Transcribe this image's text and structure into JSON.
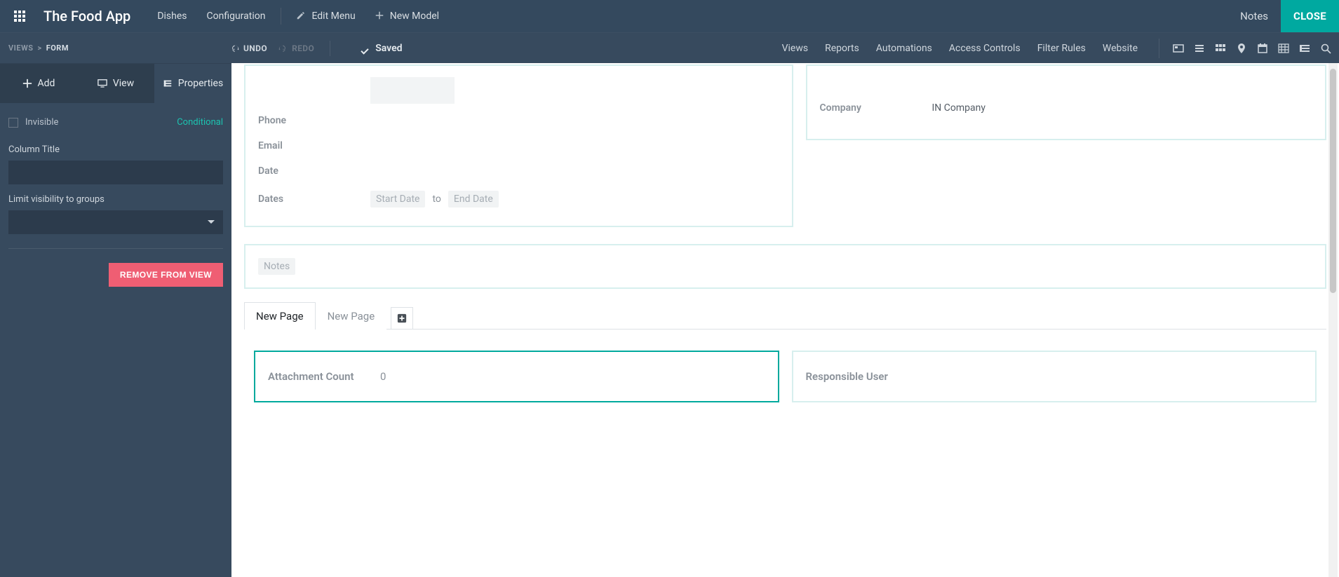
{
  "header": {
    "app_title": "The Food App",
    "nav": {
      "dishes": "Dishes",
      "configuration": "Configuration",
      "edit_menu": "Edit Menu",
      "new_model": "New Model"
    },
    "notes": "Notes",
    "close": "CLOSE"
  },
  "secondbar": {
    "breadcrumb_root": "VIEWS",
    "breadcrumb_sep": ">",
    "breadcrumb_current": "FORM",
    "undo": "UNDO",
    "redo": "REDO",
    "saved": "Saved",
    "links": {
      "views": "Views",
      "reports": "Reports",
      "automations": "Automations",
      "access_controls": "Access Controls",
      "filter_rules": "Filter Rules",
      "website": "Website"
    }
  },
  "panel": {
    "tabs": {
      "add": "Add",
      "view": "View",
      "properties": "Properties"
    },
    "invisible_label": "Invisible",
    "conditional": "Conditional",
    "column_title_label": "Column Title",
    "column_title_value": "",
    "limit_visibility_label": "Limit visibility to groups",
    "limit_visibility_value": "",
    "remove_btn": "REMOVE FROM VIEW"
  },
  "form": {
    "left_block": {
      "phone_label": "Phone",
      "email_label": "Email",
      "date_label": "Date",
      "dates_label": "Dates",
      "start_date_ph": "Start Date",
      "to": "to",
      "end_date_ph": "End Date"
    },
    "right_block": {
      "company_label": "Company",
      "company_value": "IN Company"
    },
    "notes_ph": "Notes",
    "tabs": {
      "tab1": "New Page",
      "tab2": "New Page"
    },
    "tab_body": {
      "attachment_count_label": "Attachment Count",
      "attachment_count_value": "0",
      "responsible_user_label": "Responsible User"
    }
  }
}
